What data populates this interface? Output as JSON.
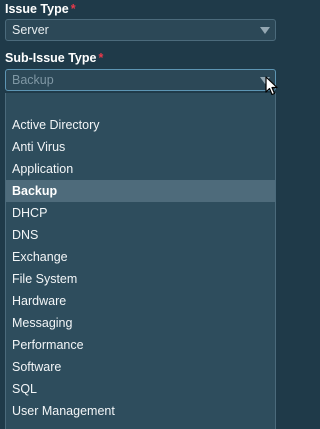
{
  "issue_type": {
    "label": "Issue Type",
    "required_mark": "*",
    "value": "Server"
  },
  "sub_issue_type": {
    "label": "Sub-Issue Type",
    "required_mark": "*",
    "value": "Backup",
    "options": [
      "Active Directory",
      "Anti Virus",
      "Application",
      "Backup",
      "DHCP",
      "DNS",
      "Exchange",
      "File System",
      "Hardware",
      "Messaging",
      "Performance",
      "Software",
      "SQL",
      "User Management"
    ],
    "highlighted_option": "Backup"
  },
  "colors": {
    "background": "#1f3a49",
    "dropdown_background": "#2e4d5d",
    "highlight": "#4e6b7b",
    "required": "#e8394a"
  },
  "icons": {
    "select_arrow": "caret-down-icon",
    "pointer": "mouse-cursor-icon"
  }
}
